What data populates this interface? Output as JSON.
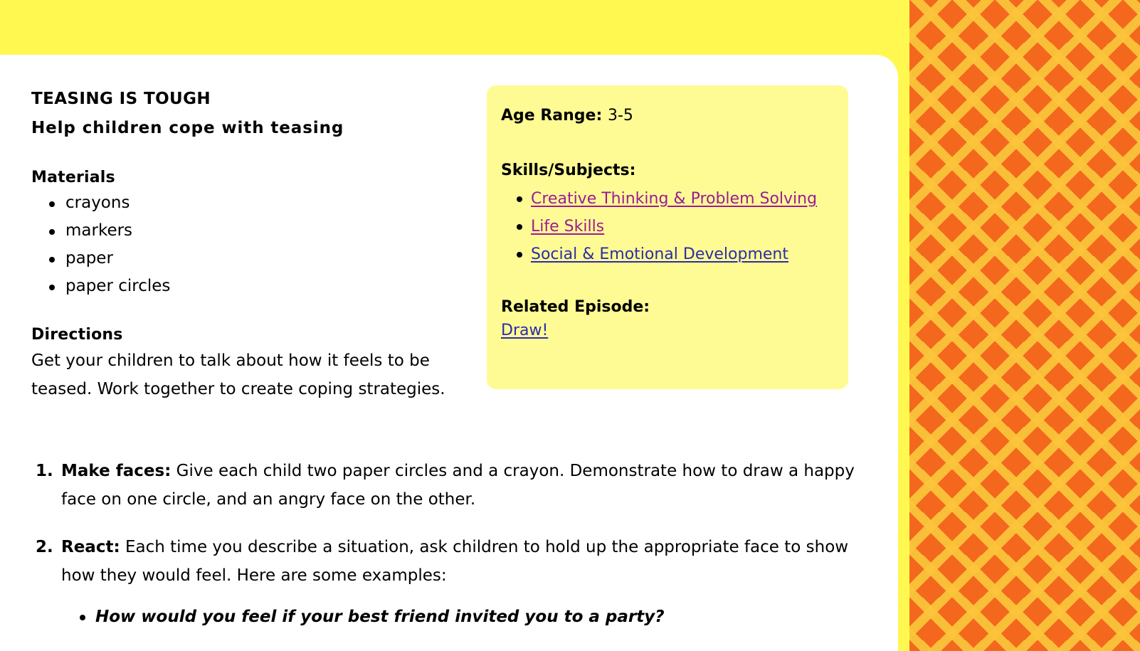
{
  "theme": {
    "band_yellow": "#FFF851",
    "card_yellow": "#FFFB94",
    "sheet_white": "#FFFFFF",
    "pattern_orange": "#F4681E",
    "pattern_yellow": "#FBC43A",
    "link_visited": "#9D1A97",
    "link_unvisited": "#2B2BAB",
    "text": "#000000"
  },
  "activity": {
    "title": "TEASING IS TOUGH",
    "subtitle": "Help children cope with teasing",
    "materials_heading": "Materials",
    "materials": [
      "crayons",
      "markers",
      "paper",
      "paper circles"
    ],
    "directions_heading": "Directions",
    "directions_text": "Get your children to talk about how it feels to be teased. Work together to create coping strategies."
  },
  "info_card": {
    "age_range_label": "Age Range:",
    "age_range_value": "3-5",
    "skills_label": "Skills/Subjects:",
    "skills": [
      {
        "text": "Creative Thinking & Problem Solving",
        "state": "visited"
      },
      {
        "text": "Life Skills",
        "state": "visited"
      },
      {
        "text": "Social & Emotional Development",
        "state": "unvisited"
      }
    ],
    "related_episode_label": "Related Episode:",
    "related_episode_link": "Draw!"
  },
  "steps": [
    {
      "number": "1.",
      "lead": "Make faces:",
      "body": " Give each child two paper circles and a crayon. Demonstrate how to draw a happy face on one circle, and an angry face on the other."
    },
    {
      "number": "2.",
      "lead": "React:",
      "body": " Each time you describe a situation, ask children to hold up the appropriate face to show how they would feel. Here are some examples:"
    }
  ],
  "examples": [
    "How would you feel if your best friend invited you to a party?"
  ]
}
